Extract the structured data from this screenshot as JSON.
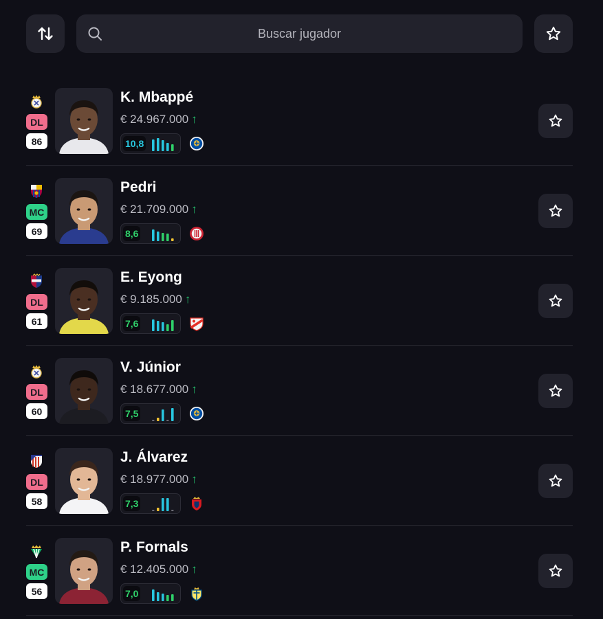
{
  "toolbar": {
    "sort_icon": "sort-arrows-icon",
    "search_placeholder": "Buscar jugador",
    "favorites_icon": "star-icon"
  },
  "colors": {
    "background": "#0f0f17",
    "surface": "#22222c",
    "pos_DL": "#f06d8c",
    "pos_MC": "#2ed189",
    "avg_cyan": "#28c7e0",
    "avg_green": "#2fd16a",
    "price_up": "#25c26e"
  },
  "players": [
    {
      "name": "K. Mbappé",
      "price": "€ 24.967.000",
      "trend": "↑",
      "position": "DL",
      "score": "86",
      "avg": "10,8",
      "avg_color": "cyan",
      "bars": [
        {
          "h": 0.85,
          "c": "cyan"
        },
        {
          "h": 0.95,
          "c": "cyan"
        },
        {
          "h": 0.8,
          "c": "cyan"
        },
        {
          "h": 0.6,
          "c": "cyan"
        },
        {
          "h": 0.5,
          "c": "green"
        }
      ],
      "club": "real-madrid-crest-icon",
      "rival": "getafe-crest-icon"
    },
    {
      "name": "Pedri",
      "price": "€ 21.709.000",
      "trend": "↑",
      "position": "MC",
      "score": "69",
      "avg": "8,6",
      "avg_color": "green",
      "bars": [
        {
          "h": 0.85,
          "c": "cyan"
        },
        {
          "h": 0.7,
          "c": "cyan"
        },
        {
          "h": 0.6,
          "c": "green"
        },
        {
          "h": 0.55,
          "c": "green"
        },
        {
          "h": 0.2,
          "c": "yellow"
        }
      ],
      "club": "barcelona-crest-icon",
      "rival": "girona-crest-icon"
    },
    {
      "name": "E. Eyong",
      "price": "€ 9.185.000",
      "trend": "↑",
      "position": "DL",
      "score": "61",
      "avg": "7,6",
      "avg_color": "green",
      "bars": [
        {
          "h": 0.85,
          "c": "cyan"
        },
        {
          "h": 0.75,
          "c": "cyan"
        },
        {
          "h": 0.65,
          "c": "cyan"
        },
        {
          "h": 0.5,
          "c": "green"
        },
        {
          "h": 0.8,
          "c": "green"
        }
      ],
      "club": "levante-crest-icon",
      "rival": "rayo-vallecano-crest-icon"
    },
    {
      "name": "V. Júnior",
      "price": "€ 18.677.000",
      "trend": "↑",
      "position": "DL",
      "score": "60",
      "avg": "7,5",
      "avg_color": "green",
      "bars": [
        {
          "h": 0.1,
          "c": "gray"
        },
        {
          "h": 0.25,
          "c": "yellow"
        },
        {
          "h": 0.85,
          "c": "cyan"
        },
        {
          "h": 0.1,
          "c": "gray"
        },
        {
          "h": 0.95,
          "c": "cyan"
        }
      ],
      "club": "real-madrid-crest-icon",
      "rival": "getafe-crest-icon"
    },
    {
      "name": "J. Álvarez",
      "price": "€ 18.977.000",
      "trend": "↑",
      "position": "DL",
      "score": "58",
      "avg": "7,3",
      "avg_color": "green",
      "bars": [
        {
          "h": 0.1,
          "c": "gray"
        },
        {
          "h": 0.25,
          "c": "yellow"
        },
        {
          "h": 0.95,
          "c": "cyan"
        },
        {
          "h": 0.95,
          "c": "cyan"
        },
        {
          "h": 0.1,
          "c": "gray"
        }
      ],
      "club": "atletico-madrid-crest-icon",
      "rival": "osasuna-crest-icon"
    },
    {
      "name": "P. Fornals",
      "price": "€ 12.405.000",
      "trend": "↑",
      "position": "MC",
      "score": "56",
      "avg": "7,0",
      "avg_color": "green",
      "bars": [
        {
          "h": 0.85,
          "c": "cyan"
        },
        {
          "h": 0.65,
          "c": "cyan"
        },
        {
          "h": 0.55,
          "c": "cyan"
        },
        {
          "h": 0.45,
          "c": "green"
        },
        {
          "h": 0.5,
          "c": "green"
        }
      ],
      "club": "real-betis-crest-icon",
      "rival": "villarreal-crest-icon"
    }
  ]
}
